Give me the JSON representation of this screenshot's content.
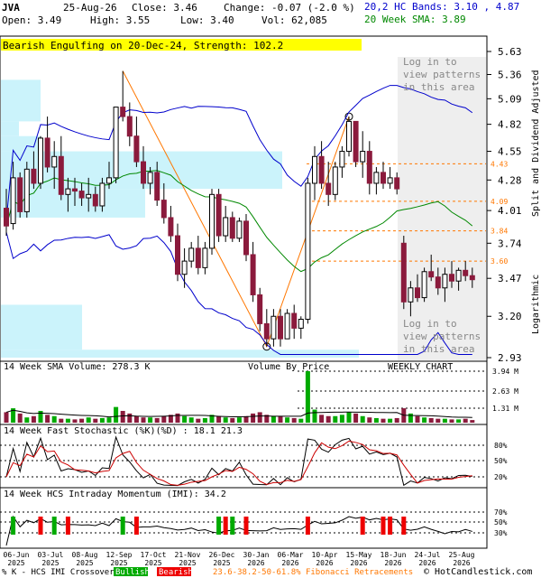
{
  "header": {
    "symbol": "JVA",
    "date": "25-Aug-26",
    "close_label": "Close: 3.46",
    "change_label": "Change: -0.07 (-2.0 %)",
    "open_label": "Open: 3.49",
    "high_label": "High: 3.55",
    "low_label": "Low: 3.40",
    "vol_label": "Vol: 62,085",
    "bands_label": "20,2 HC Bands: 3.10 , 4.87",
    "sma_label": "20 Week SMA: 3.89"
  },
  "pattern_banner": "Bearish Engulfing on 20-Dec-24, Strength: 102.2",
  "login_text": [
    "Log in to",
    "view patterns",
    "in this area"
  ],
  "panel_labels": {
    "volume_by_price": "Volume By Price",
    "weekly": "WEEKLY CHART",
    "right_axis": "Split and Dividend Adjusted",
    "logarithmic": "Logarithmic",
    "vol_title": "14 Week SMA Volume: 278.3 K",
    "stoch_title": "14 Week Fast Stochastic (%K)(%D) : 18.1  21.3",
    "mom_title": "14 Week HCS Intraday Momentum (IMI): 34.2"
  },
  "footer": {
    "legend_prefix": "% K - HCS IMI Crossover,",
    "bullish": "Bullish",
    "bearish": "Bearish",
    "fib": "23.6-38.2-50-61.8% Fibonacci Retracements",
    "copyright": "© HotCandlestick.com"
  },
  "colors": {
    "bull": "#ffffff",
    "bear": "#8b1a3c",
    "band": "#0000cc",
    "sma": "#008800",
    "vbp": "#cbf3fb",
    "fib": "#ff7700",
    "banner": "#ffff00",
    "green_bar": "#00aa00",
    "red_bar": "#ee0000"
  },
  "chart_data": {
    "type": "candlestick",
    "scale": "log",
    "price_ticks": [
      5.63,
      5.36,
      5.09,
      4.82,
      4.55,
      4.28,
      4.01,
      3.74,
      3.47,
      3.2,
      2.93
    ],
    "fib_levels": [
      4.43,
      4.09,
      3.84,
      3.6
    ],
    "x_ticks": [
      "06-Jun 2025",
      "03-Jul 2025",
      "08-Aug 2025",
      "12-Sep 2025",
      "17-Oct 2025",
      "21-Nov 2025",
      "26-Dec 2025",
      "30-Jan 2026",
      "06-Mar 2026",
      "10-Apr 2026",
      "15-May 2026",
      "18-Jun 2026",
      "24-Jul 2026",
      "25-Aug 2026"
    ],
    "ohlc": [
      [
        4.03,
        4.2,
        3.8,
        3.88
      ],
      [
        3.9,
        4.45,
        3.85,
        4.3
      ],
      [
        4.3,
        4.35,
        3.95,
        4.0
      ],
      [
        4.0,
        4.45,
        3.95,
        4.38
      ],
      [
        4.38,
        4.55,
        4.2,
        4.25
      ],
      [
        4.25,
        4.7,
        4.2,
        4.68
      ],
      [
        4.68,
        4.9,
        4.35,
        4.4
      ],
      [
        4.4,
        4.65,
        4.2,
        4.5
      ],
      [
        4.5,
        4.7,
        4.1,
        4.15
      ],
      [
        4.15,
        4.3,
        4.0,
        4.2
      ],
      [
        4.2,
        4.3,
        4.05,
        4.18
      ],
      [
        4.18,
        4.25,
        4.05,
        4.12
      ],
      [
        4.12,
        4.3,
        4.0,
        4.15
      ],
      [
        4.15,
        4.22,
        4.0,
        4.05
      ],
      [
        4.05,
        4.3,
        4.0,
        4.25
      ],
      [
        4.25,
        4.45,
        4.2,
        4.3
      ],
      [
        4.3,
        5.0,
        4.25,
        5.0
      ],
      [
        5.0,
        5.4,
        4.85,
        4.9
      ],
      [
        4.9,
        5.05,
        4.6,
        4.7
      ],
      [
        4.7,
        4.9,
        4.4,
        4.45
      ],
      [
        4.45,
        4.6,
        4.2,
        4.25
      ],
      [
        4.25,
        4.4,
        4.15,
        4.35
      ],
      [
        4.35,
        4.45,
        4.05,
        4.1
      ],
      [
        4.1,
        4.25,
        3.9,
        3.95
      ],
      [
        3.95,
        4.05,
        3.75,
        3.8
      ],
      [
        3.8,
        3.9,
        3.45,
        3.5
      ],
      [
        3.5,
        3.7,
        3.4,
        3.6
      ],
      [
        3.6,
        3.75,
        3.55,
        3.7
      ],
      [
        3.7,
        3.8,
        3.5,
        3.55
      ],
      [
        3.55,
        3.75,
        3.5,
        3.7
      ],
      [
        3.7,
        4.2,
        3.65,
        4.15
      ],
      [
        4.15,
        4.2,
        3.75,
        3.8
      ],
      [
        3.8,
        4.05,
        3.75,
        3.95
      ],
      [
        3.95,
        4.0,
        3.75,
        3.78
      ],
      [
        3.78,
        3.95,
        3.75,
        3.92
      ],
      [
        3.92,
        3.98,
        3.6,
        3.65
      ],
      [
        3.65,
        3.75,
        3.3,
        3.35
      ],
      [
        3.35,
        3.4,
        3.1,
        3.15
      ],
      [
        3.15,
        3.25,
        3.0,
        3.05
      ],
      [
        3.05,
        3.25,
        3.0,
        3.2
      ],
      [
        3.2,
        3.25,
        3.0,
        3.05
      ],
      [
        3.05,
        3.25,
        3.05,
        3.22
      ],
      [
        3.22,
        3.28,
        3.05,
        3.12
      ],
      [
        3.12,
        3.2,
        3.05,
        3.18
      ],
      [
        3.18,
        4.3,
        3.15,
        4.25
      ],
      [
        4.25,
        4.6,
        4.1,
        4.5
      ],
      [
        4.5,
        4.65,
        4.2,
        4.25
      ],
      [
        4.25,
        4.45,
        4.05,
        4.15
      ],
      [
        4.15,
        4.45,
        4.1,
        4.4
      ],
      [
        4.4,
        4.6,
        4.3,
        4.55
      ],
      [
        4.55,
        4.9,
        4.5,
        4.85
      ],
      [
        4.85,
        4.85,
        4.4,
        4.45
      ],
      [
        4.45,
        4.75,
        4.3,
        4.55
      ],
      [
        4.55,
        4.65,
        4.15,
        4.25
      ],
      [
        4.25,
        4.4,
        4.15,
        4.35
      ],
      [
        4.35,
        4.45,
        4.2,
        4.25
      ],
      [
        4.25,
        4.4,
        4.2,
        4.3
      ],
      [
        4.3,
        4.35,
        4.15,
        4.2
      ],
      [
        3.74,
        3.8,
        3.25,
        3.3
      ],
      [
        3.3,
        3.45,
        3.2,
        3.4
      ],
      [
        3.4,
        3.5,
        3.3,
        3.33
      ],
      [
        3.33,
        3.55,
        3.3,
        3.52
      ],
      [
        3.52,
        3.65,
        3.45,
        3.48
      ],
      [
        3.48,
        3.55,
        3.35,
        3.4
      ],
      [
        3.4,
        3.55,
        3.3,
        3.5
      ],
      [
        3.5,
        3.6,
        3.4,
        3.45
      ],
      [
        3.45,
        3.55,
        3.38,
        3.53
      ],
      [
        3.53,
        3.6,
        3.45,
        3.49
      ],
      [
        3.49,
        3.55,
        3.4,
        3.46
      ]
    ],
    "volume_ticks": [
      "3.94 M",
      "2.63 M",
      "1.31 M"
    ],
    "stoch_ticks": [
      "80%",
      "50%",
      "20%"
    ],
    "mom_ticks": [
      "70%",
      "50%",
      "30%"
    ]
  }
}
